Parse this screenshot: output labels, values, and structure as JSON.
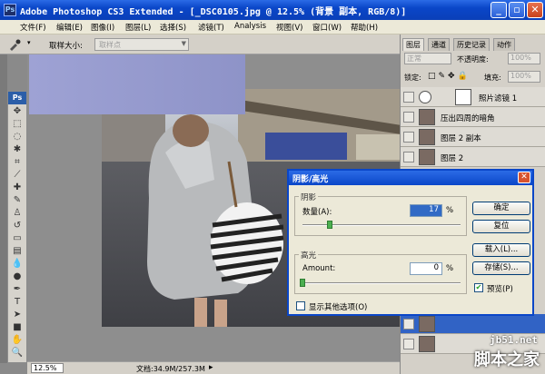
{
  "window": {
    "title": "Adobe Photoshop CS3 Extended - [_DSC0105.jpg @ 12.5% (背景 副本, RGB/8)]",
    "app_icon": "Ps",
    "minimize": "_",
    "restore": "▫",
    "close": "✕"
  },
  "menu": [
    "文件(F)",
    "编辑(E)",
    "图像(I)",
    "图层(L)",
    "选择(S)",
    "滤镜(T)",
    "Analysis",
    "视图(V)",
    "窗口(W)",
    "帮助(H)"
  ],
  "options": {
    "sample_size_label": "取样大小:",
    "sample_size_value": "取样点"
  },
  "toolbox": {
    "logo": "Ps"
  },
  "status": {
    "zoom": "12.5%",
    "doc": "文档:34.9M/257.3M",
    "arrow": "▸"
  },
  "layers_panel": {
    "tabs": [
      "图层",
      "通道",
      "历史记录",
      "动作"
    ],
    "blend_mode": "正常",
    "opacity_label": "不透明度:",
    "opacity_value": "100%",
    "lock_label": "锁定:",
    "fill_label": "填充:",
    "fill_value": "100%",
    "layers": [
      {
        "name": "照片滤镜 1"
      },
      {
        "name": "压出四周的暗角"
      },
      {
        "name": "图层 2 副本"
      },
      {
        "name": "图层 2"
      }
    ]
  },
  "dialog": {
    "title": "阴影/高光",
    "shadows_group": "阴影",
    "amount_label": "数量(A):",
    "shadow_amount": "17",
    "percent": "%",
    "highlights_group": "高光",
    "highlight_amount_label": "Amount:",
    "highlight_amount": "0",
    "show_more": "显示其他选项(O)",
    "buttons": {
      "ok": "确定",
      "reset": "复位",
      "load": "载入(L)...",
      "save": "存储(S)...",
      "preview": "预览(P)"
    },
    "shadow_slider": 0.17,
    "highlight_slider": 0.0
  },
  "watermark": {
    "line1": "jb51.net",
    "line2": "脚本之家"
  },
  "colors": {
    "title_bar": "#0a46c8",
    "dialog_face": "#ece9d8",
    "selected_layer": "#3163c5"
  }
}
